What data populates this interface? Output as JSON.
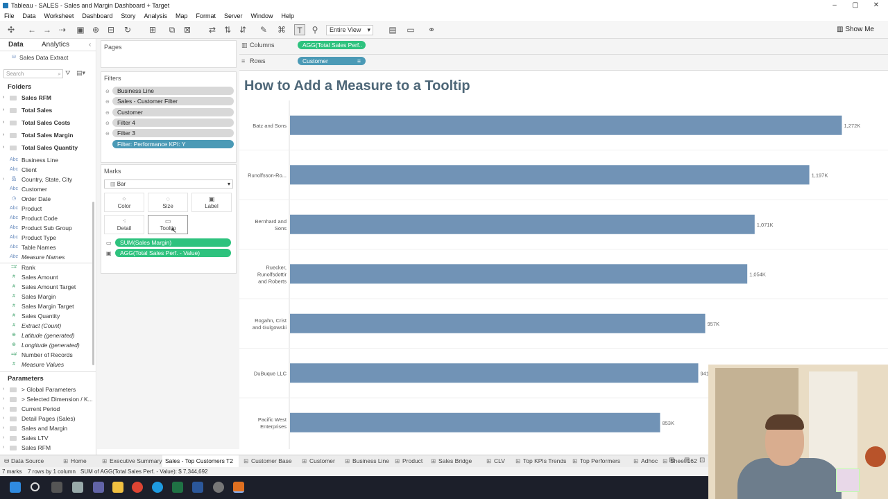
{
  "window": {
    "title": "Tableau - SALES - Sales and Margin Dashboard + Target"
  },
  "menu": [
    "File",
    "Data",
    "Worksheet",
    "Dashboard",
    "Story",
    "Analysis",
    "Map",
    "Format",
    "Server",
    "Window",
    "Help"
  ],
  "toolbar": {
    "view_mode": "Entire View",
    "show_me": "Show Me"
  },
  "left_pane": {
    "tabs": [
      "Data",
      "Analytics"
    ],
    "datasource": "Sales Data Extract",
    "search_placeholder": "Search",
    "folders_header": "Folders",
    "folders": [
      "Sales RFM",
      "Total Sales",
      "Total Sales Costs",
      "Total Sales Margin",
      "Total Sales Quantity"
    ],
    "dimensions": [
      {
        "icon": "Abc",
        "label": "Business Line"
      },
      {
        "icon": "Abc",
        "label": "Client"
      },
      {
        "icon": "geo",
        "label": "Country, State, City"
      },
      {
        "icon": "Abc",
        "label": "Customer"
      },
      {
        "icon": "date",
        "label": "Order Date"
      },
      {
        "icon": "Abc",
        "label": "Product"
      },
      {
        "icon": "Abc",
        "label": "Product Code"
      },
      {
        "icon": "Abc",
        "label": "Product Sub Group"
      },
      {
        "icon": "Abc",
        "label": "Product Type"
      },
      {
        "icon": "Abc",
        "label": "Table Names"
      },
      {
        "icon": "Abc",
        "label": "Measure Names",
        "italic": true
      }
    ],
    "measures": [
      {
        "label": "Rank"
      },
      {
        "label": "Sales Amount"
      },
      {
        "label": "Sales Amount Target"
      },
      {
        "label": "Sales Margin"
      },
      {
        "label": "Sales Margin Target"
      },
      {
        "label": "Sales Quantity"
      },
      {
        "label": "Extract (Count)",
        "italic": true
      },
      {
        "label": "Latitude (generated)",
        "italic": true
      },
      {
        "label": "Longitude (generated)",
        "italic": true
      },
      {
        "label": "Number of Records"
      },
      {
        "label": "Measure Values",
        "italic": true
      }
    ],
    "parameters_header": "Parameters",
    "parameters": [
      "> Global Parameters",
      "> Selected Dimension / K...",
      "Current Period",
      "Detail Pages (Sales)",
      "Sales and Margin",
      "Sales LTV",
      "Sales RFM"
    ]
  },
  "pages": {
    "title": "Pages"
  },
  "filters": {
    "title": "Filters",
    "items": [
      "Business Line",
      "Sales - Customer Filter",
      "Customer",
      "Filter 4",
      "Filter 3",
      "Filter: Performance KPI: Y"
    ]
  },
  "marks": {
    "title": "Marks",
    "type": "Bar",
    "buttons": [
      "Color",
      "Size",
      "Label",
      "Detail",
      "Tooltip"
    ],
    "fields": [
      "SUM(Sales Margin)",
      "AGG(Total Sales Perf. - Value)"
    ]
  },
  "shelves": {
    "columns_label": "Columns",
    "columns_pill": "AGG(Total Sales Perf..",
    "rows_label": "Rows",
    "rows_pill": "Customer"
  },
  "chart_data": {
    "type": "bar",
    "orientation": "horizontal",
    "title": "How to Add a Measure to a Tooltip",
    "categories": [
      "Batz and Sons",
      "Runolfsson-Ro...",
      "Bernhard and Sons",
      "Ruecker, Runolfsdottir and Roberts",
      "Rogahn, Crist and Gulgowski",
      "DuBuque LLC",
      "Pacific West Enterprises"
    ],
    "values": [
      1272,
      1197,
      1071,
      1054,
      957,
      941,
      853
    ],
    "data_labels": [
      "1,272K",
      "1,197K",
      "1,071K",
      "1,054K",
      "957K",
      "941K",
      "853K"
    ],
    "units": "K",
    "bar_color": "#7193b6",
    "xlim": [
      0,
      1300
    ]
  },
  "sheet_tabs": {
    "datasource": "Data Source",
    "tabs": [
      "Home",
      "Executive Summary",
      "Sales - Top Customers T2",
      "Customer Base",
      "Customer",
      "Business Line",
      "Product",
      "Sales Bridge",
      "CLV",
      "Top KPIs Trends",
      "Top Performers",
      "Adhoc",
      "Sheet 162"
    ],
    "active": "Sales - Top Customers T2"
  },
  "status": {
    "marks": "7 marks",
    "rows_cols": "7 rows by 1 column",
    "sum": "SUM of AGG(Total Sales Perf. - Value): $ 7,344,692"
  },
  "colors": {
    "accent_green": "#2ec27e",
    "accent_blue": "#4b9ab6",
    "title": "#4e6778"
  }
}
